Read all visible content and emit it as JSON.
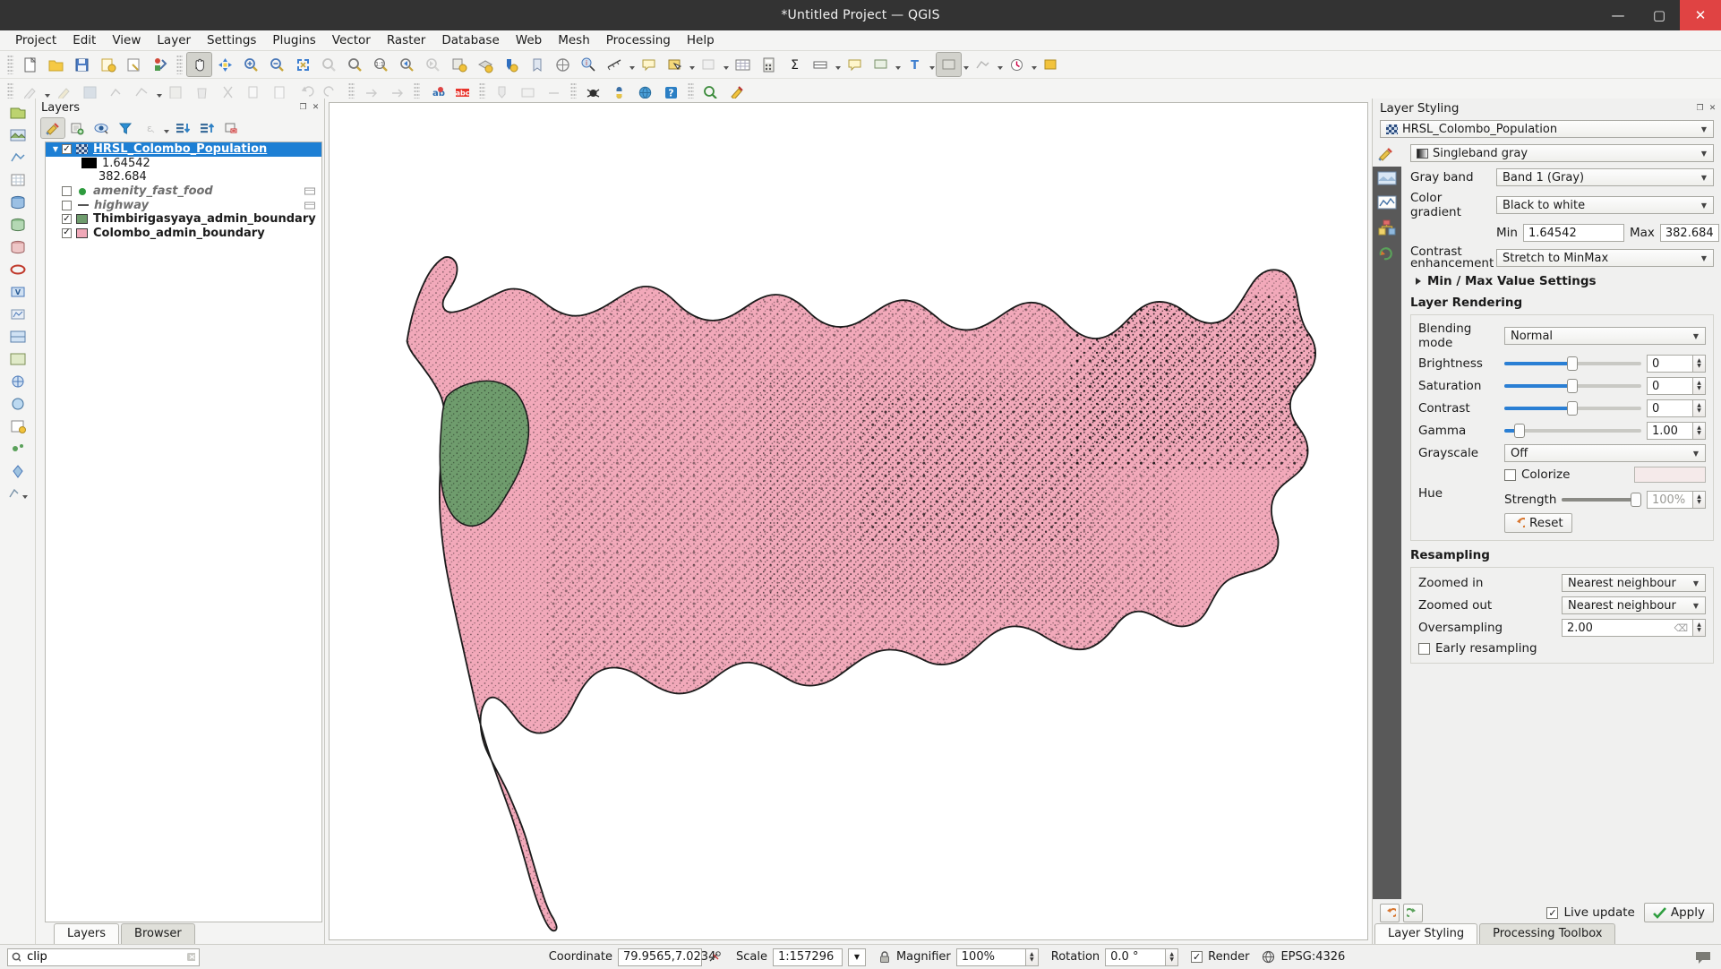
{
  "window": {
    "title": "*Untitled Project — QGIS",
    "minimize": "—",
    "maximize": "▢",
    "close": "✕"
  },
  "menubar": {
    "items": [
      "Project",
      "Edit",
      "View",
      "Layer",
      "Settings",
      "Plugins",
      "Vector",
      "Raster",
      "Database",
      "Web",
      "Mesh",
      "Processing",
      "Help"
    ]
  },
  "layers_panel": {
    "title": "Layers",
    "tabs": [
      {
        "label": "Layers",
        "active": true
      },
      {
        "label": "Browser",
        "active": false
      }
    ],
    "toolbar_icons": [
      "open-layer-styling-panel-icon",
      "add-group-icon",
      "manage-map-themes-icon",
      "filter-legend-icon",
      "filter-legend-by-expression-icon",
      "expand-all-icon",
      "collapse-all-icon",
      "remove-layer-icon"
    ],
    "items": [
      {
        "name": "HRSL_Colombo_Population",
        "checked": true,
        "selected": true,
        "type": "raster",
        "expanded": true
      },
      {
        "name": "1.64542",
        "type": "raster-legend-min"
      },
      {
        "name": "382.684",
        "type": "raster-legend-max"
      },
      {
        "name": "amenity_fast_food",
        "checked": false,
        "selected": false,
        "type": "point"
      },
      {
        "name": "highway",
        "checked": false,
        "selected": false,
        "type": "line"
      },
      {
        "name": "Thimbirigasyaya_admin_boundary",
        "checked": true,
        "selected": false,
        "type": "polygon-green"
      },
      {
        "name": "Colombo_admin_boundary",
        "checked": true,
        "selected": false,
        "type": "polygon-pink"
      }
    ]
  },
  "layer_styling": {
    "title": "Layer Styling",
    "layer_selected": "HRSL_Colombo_Population",
    "renderer": "Singleband gray",
    "fields": {
      "gray_band_label": "Gray band",
      "gray_band_value": "Band 1 (Gray)",
      "color_gradient_label": "Color gradient",
      "color_gradient_value": "Black to white",
      "min_label": "Min",
      "min_value": "1.64542",
      "max_label": "Max",
      "max_value": "382.684",
      "contrast_label": "Contrast enhancement",
      "contrast_value": "Stretch to MinMax",
      "minmax_settings": "Min / Max Value Settings"
    },
    "layer_rendering": {
      "title": "Layer Rendering",
      "blending_label": "Blending mode",
      "blending_value": "Normal",
      "brightness_label": "Brightness",
      "brightness_value": "0",
      "saturation_label": "Saturation",
      "saturation_value": "0",
      "contrast_label": "Contrast",
      "contrast_value": "0",
      "gamma_label": "Gamma",
      "gamma_value": "1.00",
      "grayscale_label": "Grayscale",
      "grayscale_value": "Off",
      "hue_label": "Hue",
      "colorize_label": "Colorize",
      "colorize_checked": false,
      "strength_label": "Strength",
      "strength_value": "100%",
      "reset_label": "Reset"
    },
    "resampling": {
      "title": "Resampling",
      "zoomed_in_label": "Zoomed in",
      "zoomed_in_value": "Nearest neighbour",
      "zoomed_out_label": "Zoomed out",
      "zoomed_out_value": "Nearest neighbour",
      "oversampling_label": "Oversampling",
      "oversampling_value": "2.00",
      "early_resampling_label": "Early resampling",
      "early_resampling_checked": false
    },
    "footer": {
      "undo_icon": "undo-icon",
      "redo_icon": "redo-icon",
      "live_update_label": "Live update",
      "live_update_checked": true,
      "apply_label": "Apply"
    },
    "tabs": [
      {
        "label": "Layer Styling",
        "active": true
      },
      {
        "label": "Processing Toolbox",
        "active": false
      }
    ]
  },
  "statusbar": {
    "search_value": "clip",
    "search_placeholder": "",
    "coordinate_label": "Coordinate",
    "coordinate_value": "79.9565,7.0234",
    "scale_label": "Scale",
    "scale_value": "1:157296",
    "magnifier_label": "Magnifier",
    "magnifier_value": "100%",
    "rotation_label": "Rotation",
    "rotation_value": "0.0 °",
    "render_label": "Render",
    "render_checked": true,
    "crs_label": "EPSG:4326"
  },
  "colors": {
    "accent_blue": "#1d7fd4",
    "colombo_pink": "#f0a8b8",
    "thimbirigasyaya_green": "#6f9c6d",
    "titlebar": "#333333",
    "close_red": "#e04343"
  }
}
